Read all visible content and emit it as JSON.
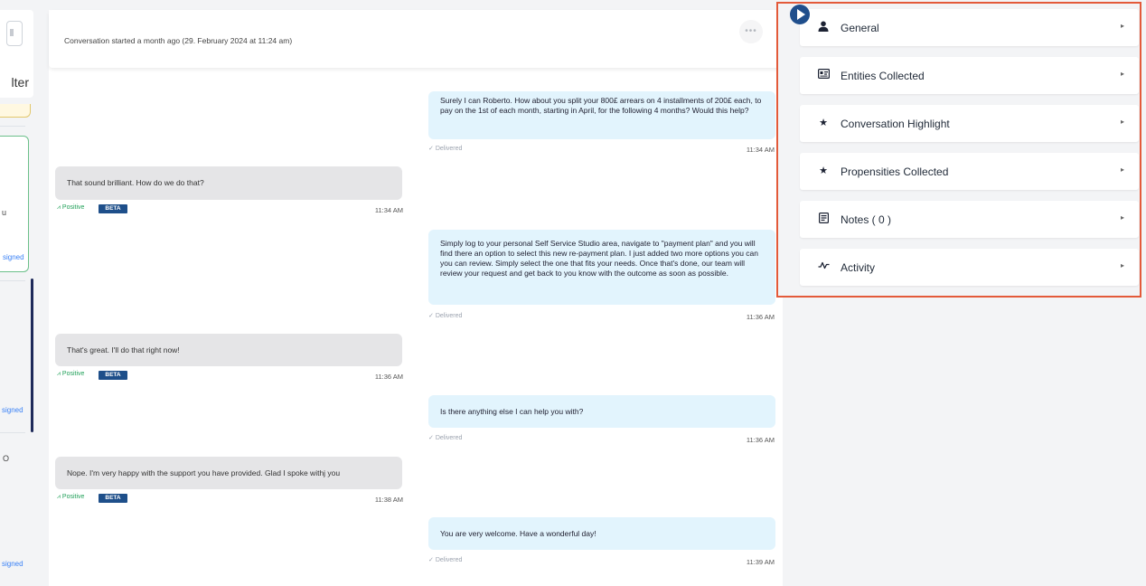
{
  "sidebar": {
    "filter_label": "lter",
    "card1_text": "u",
    "card1_assigned": "signed",
    "card2_assigned": "signed",
    "card3_text": "O",
    "card3_assigned": "signed"
  },
  "conversation": {
    "started_text": "Conversation started a month ago (29. February 2024 at 11:24 am)",
    "more_icon": "ellipsis-icon",
    "messages": [
      {
        "sender": "agent",
        "text": "Surely I can Roberto. How about you split your 800£ arrears on 4 installments of 200£ each, to pay on the 1st of each month, starting in April, for the following 4 months? Would this help?",
        "status": "Delivered",
        "time": "11:34 AM"
      },
      {
        "sender": "user",
        "text": "That sound brilliant. How do we do that?",
        "sentiment": "Positive",
        "badge": "BETA",
        "time": "11:34 AM"
      },
      {
        "sender": "agent",
        "text": "Simply log to your personal Self Service Studio area, navigate to \"payment plan\" and you will find there an option to select this new re-payment plan. I just added two more options you can you can review. Simply select the one that fits your needs. Once that's done, our team will review your request and get back to you know with the outcome as soon as possible.",
        "status": "Delivered",
        "time": "11:36 AM"
      },
      {
        "sender": "user",
        "text": "That's great. I'll do that right now!",
        "sentiment": "Positive",
        "badge": "BETA",
        "time": "11:36 AM"
      },
      {
        "sender": "agent",
        "text": "Is there anything else I can help you with?",
        "status": "Delivered",
        "time": "11:36 AM"
      },
      {
        "sender": "user",
        "text": "Nope. I'm very happy with the support you have provided. Glad I spoke withj you",
        "sentiment": "Positive",
        "badge": "BETA",
        "time": "11:38 AM"
      },
      {
        "sender": "agent",
        "text": "You are very welcome. Have a wonderful day!",
        "status": "Delivered",
        "time": "11:39 AM"
      }
    ]
  },
  "panel": {
    "sections": [
      {
        "label": "General",
        "icon": "person-icon"
      },
      {
        "label": "Entities Collected",
        "icon": "id-card-icon"
      },
      {
        "label": "Conversation Highlight",
        "icon": "star-icon"
      },
      {
        "label": "Propensities Collected",
        "icon": "star-icon"
      },
      {
        "label": "Notes ( 0 )",
        "icon": "note-icon"
      },
      {
        "label": "Activity",
        "icon": "activity-icon"
      }
    ]
  },
  "colors": {
    "accent": "#1f4e8c",
    "highlight_border": "#e35a3a",
    "agent_bubble": "#e2f4fd",
    "user_bubble": "#e5e5e7",
    "positive": "#22a15a"
  }
}
